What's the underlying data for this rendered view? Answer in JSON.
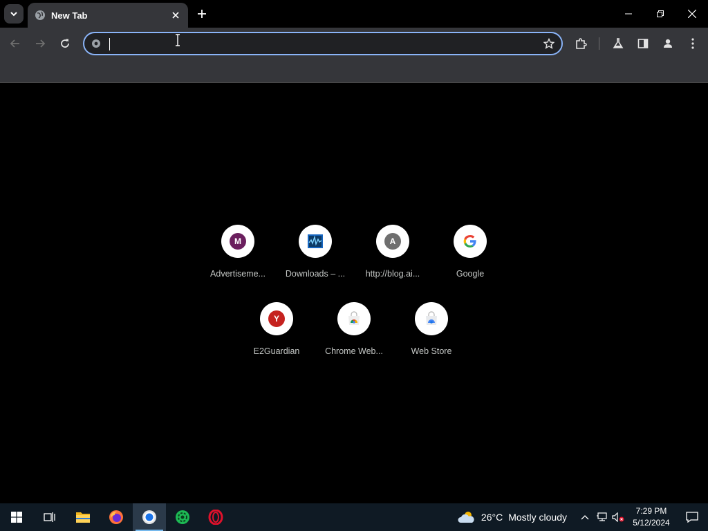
{
  "browser": {
    "tab_title": "New Tab",
    "omnibox_value": "",
    "colors": {
      "accent": "#8ab4f8",
      "toolbar": "#35363a",
      "page_bg": "#000000"
    }
  },
  "shortcuts": [
    {
      "label": "Advertiseme...",
      "icon_letter": "M",
      "icon_color": "#6b1f5e"
    },
    {
      "label": "Downloads – ...",
      "icon": "monitor-graph-icon"
    },
    {
      "label": "http://blog.ai...",
      "icon_letter": "A",
      "icon_color": "#6f6f6f"
    },
    {
      "label": "Google",
      "icon": "google-g-icon"
    },
    {
      "label": "E2Guardian",
      "icon_letter": "Y",
      "icon_color": "#c5221f"
    },
    {
      "label": "Chrome Web...",
      "icon": "chrome-web-store-icon"
    },
    {
      "label": "Web Store",
      "icon": "web-store-icon"
    }
  ],
  "taskbar": {
    "weather_temp": "26°C",
    "weather_text": "Mostly cloudy",
    "time": "7:29 PM",
    "date": "5/12/2024"
  }
}
